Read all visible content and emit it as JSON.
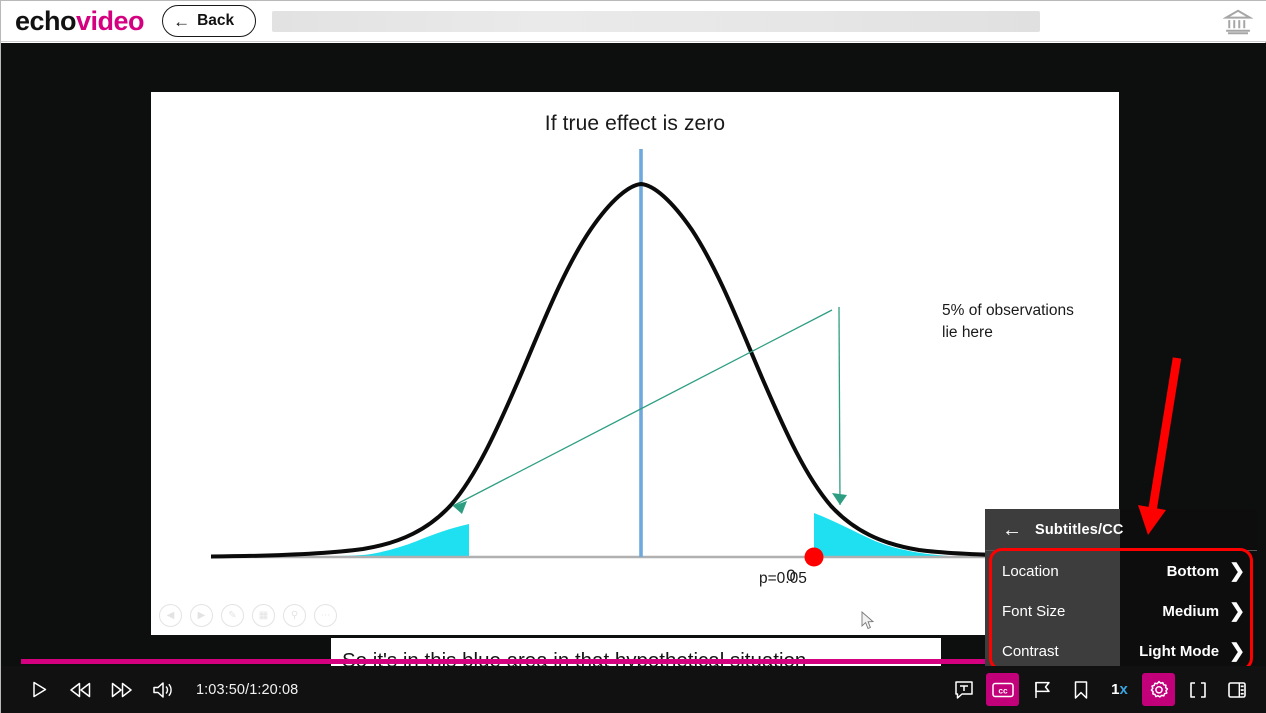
{
  "header": {
    "logo_echo": "echo",
    "logo_video": "video",
    "back_label": "Back",
    "back_arrow": "←",
    "title_placeholder": "",
    "institution_icon": "bank-icon"
  },
  "slide": {
    "title": "If true effect is zero",
    "zero_label": "0",
    "p_label": "p=0.05",
    "annotation_line1": "5% of observations",
    "annotation_line2": "lie here",
    "curve_color": "#000000",
    "center_line_color": "#6fa8dc",
    "tail_fill_color": "#1ee0f0",
    "marker_color": "#ff0000",
    "annotation_arrow_color": "#2e9e82",
    "presenter_tools": [
      "prev-icon",
      "next-icon",
      "pen-icon",
      "slides-icon",
      "zoom-icon",
      "more-icon"
    ]
  },
  "caption": {
    "text": "So it's in this blue area in that hypothetical situation"
  },
  "settings_menu": {
    "back_arrow": "←",
    "title": "Subtitles/CC",
    "rows": [
      {
        "label": "Location",
        "value": "Bottom",
        "chevron": "❯"
      },
      {
        "label": "Font Size",
        "value": "Medium",
        "chevron": "❯"
      },
      {
        "label": "Contrast",
        "value": "Light Mode",
        "chevron": "❯"
      }
    ],
    "highlight_color": "#fe0000"
  },
  "player": {
    "time": "1:03:50/1:20:08",
    "progress_percent": 79.7,
    "progress_color": "#d4007f",
    "left_controls": [
      {
        "name": "play-button",
        "icon": "play-icon"
      },
      {
        "name": "rewind-button",
        "icon": "rewind-icon"
      },
      {
        "name": "fast-forward-button",
        "icon": "fast-forward-icon"
      },
      {
        "name": "volume-button",
        "icon": "volume-icon"
      }
    ],
    "speed_value": "1",
    "speed_unit": "x",
    "right_controls": [
      {
        "name": "transcript-button",
        "icon": "transcript-icon",
        "active": false
      },
      {
        "name": "closed-captions-button",
        "icon": "cc-icon",
        "active": true
      },
      {
        "name": "flag-button",
        "icon": "flag-icon",
        "active": false
      },
      {
        "name": "bookmark-button",
        "icon": "bookmark-icon",
        "active": false
      },
      {
        "name": "playback-speed-button",
        "icon": "speed-icon",
        "active": false
      },
      {
        "name": "settings-button",
        "icon": "gear-icon",
        "active": true
      },
      {
        "name": "fullscreen-button",
        "icon": "fullscreen-icon",
        "active": false
      },
      {
        "name": "layout-button",
        "icon": "layout-icon",
        "active": false
      }
    ]
  },
  "chart_data": {
    "type": "area",
    "title": "If true effect is zero",
    "xlabel": "",
    "ylabel": "",
    "description": "Normal distribution density curve with shaded 5% tail regions on both sides",
    "x_tick_labels": [
      "0",
      "p=0.05"
    ],
    "annotations": [
      "5% of observations lie here"
    ],
    "markers": [
      {
        "label": "p=0.05",
        "color": "#ff0000",
        "x_position": 1.645
      }
    ],
    "shaded_regions": [
      {
        "side": "left",
        "fill": "#1ee0f0",
        "area_percent": 2.5
      },
      {
        "side": "right",
        "fill": "#1ee0f0",
        "area_percent": 2.5
      }
    ],
    "center_line": {
      "x": 0,
      "color": "#6fa8dc"
    },
    "grid": false,
    "legend": "none"
  }
}
